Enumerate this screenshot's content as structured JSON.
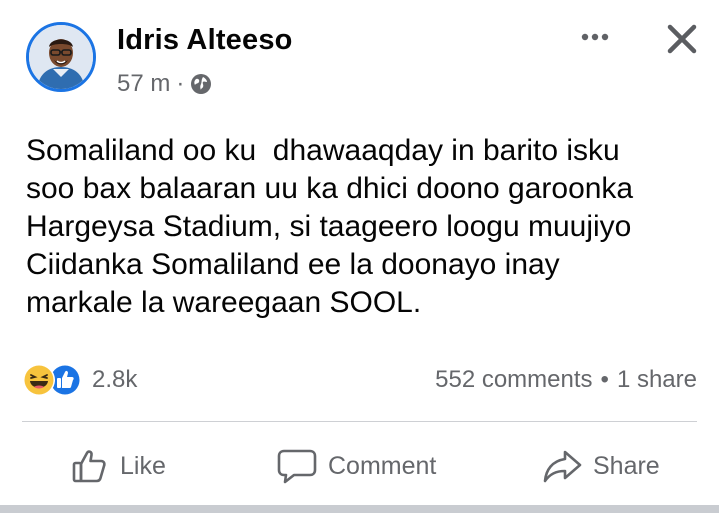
{
  "post": {
    "author": "Idris Alteeso",
    "time": "57 m",
    "separator": "·",
    "audience_icon": "globe-icon",
    "text": "Somaliland oo ku  dhawaaqday in barito isku\nsoo bax balaaran uu ka dhici doono garoonka\nHargeysa Stadium, si taageero loogu muujiyo\nCiidanka Somaliland ee la doonayo inay\nmarkale la wareegaan SOOL."
  },
  "stats": {
    "reaction_icons": [
      "haha-reaction-icon",
      "like-reaction-icon"
    ],
    "reaction_count": "2.8k",
    "comments": "552 comments",
    "dot": "•",
    "shares": "1 share"
  },
  "actions": {
    "like_label": "Like",
    "comment_label": "Comment",
    "share_label": "Share"
  },
  "colors": {
    "accent": "#1b74e4",
    "secondary_text": "#65676b",
    "primary_text": "#050505"
  }
}
